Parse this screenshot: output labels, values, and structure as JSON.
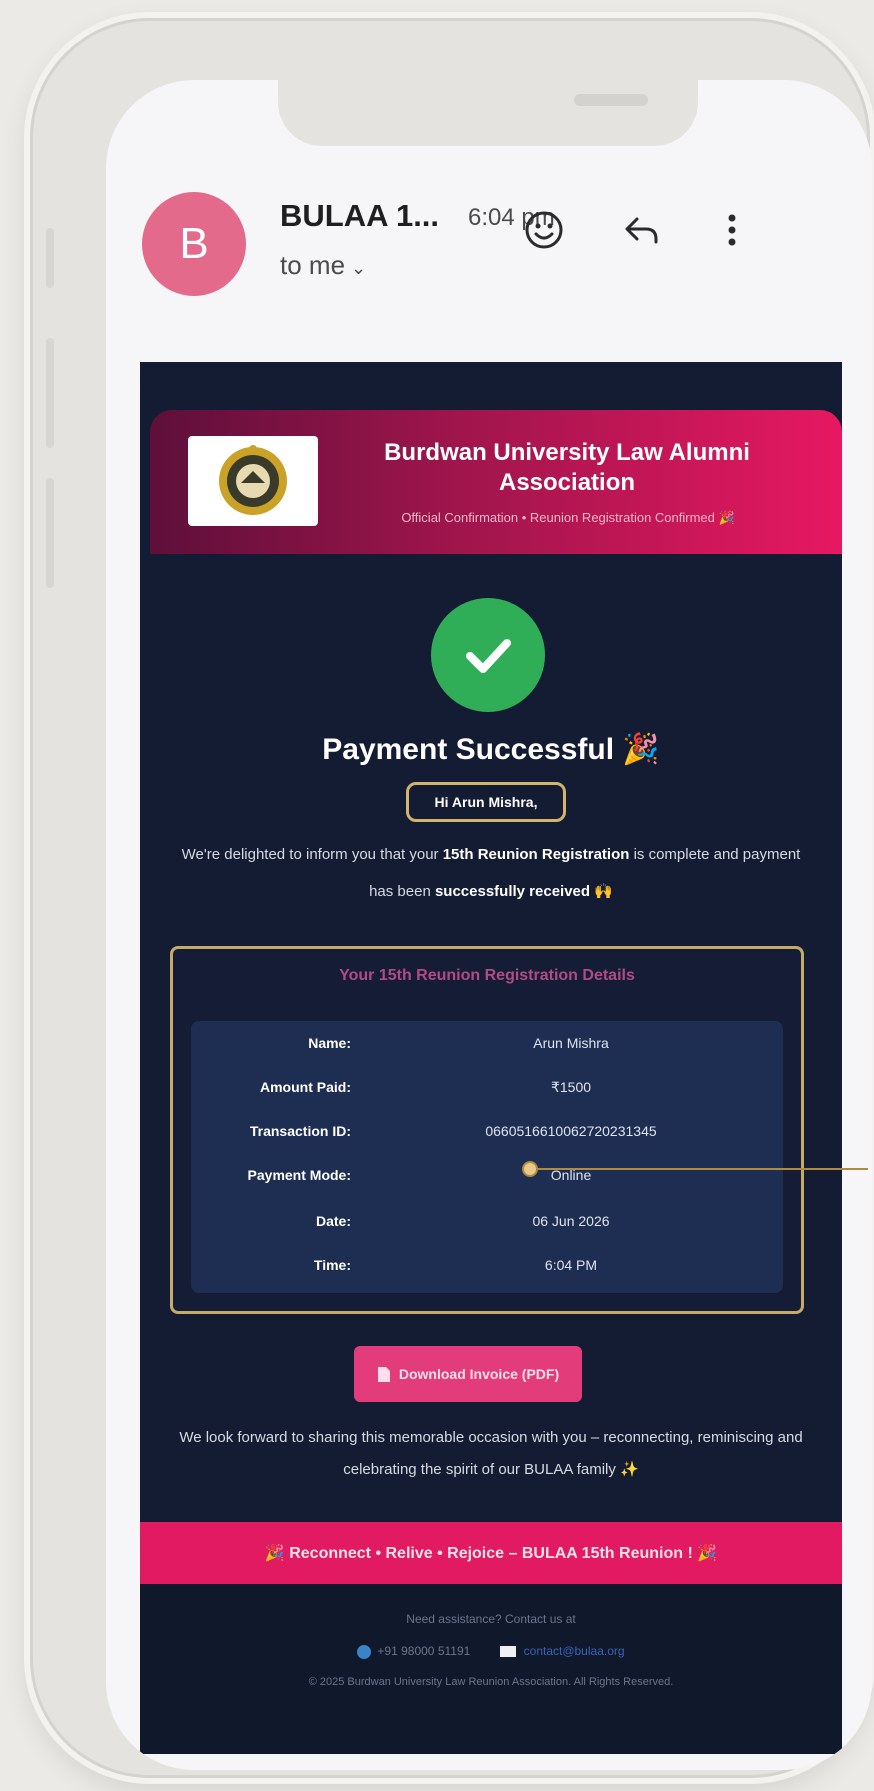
{
  "header": {
    "avatar_letter": "B",
    "sender": "BULAA 1...",
    "time": "6:04 pm",
    "recipient": "to me",
    "icons": [
      "emoji-icon",
      "reply-icon",
      "more-vert-icon"
    ]
  },
  "email": {
    "org_name": "Burdwan University Law Alumni Association",
    "subtitle": "Official Confirmation • Reunion Registration Confirmed 🎉",
    "status_title": "Payment Successful 🎉",
    "name_pill": "Hi Arun Mishra,",
    "intro_prefix": "We're delighted to inform you that your ",
    "intro_bold1": "15th Reunion Registration",
    "intro_mid": " is complete and payment has been ",
    "intro_bold2": "successfully received",
    "intro_suffix": " 🙌",
    "details_title": "Your 15th Reunion Registration Details",
    "details": [
      {
        "label": "Name:",
        "value": "Arun Mishra"
      },
      {
        "label": "Amount Paid:",
        "value": "₹1500"
      },
      {
        "label": "Transaction ID:",
        "value": "0660516610062720231345"
      },
      {
        "label": "Payment Mode:",
        "value": "Online"
      },
      {
        "label": "Date:",
        "value": "06 Jun 2026"
      },
      {
        "label": "Time:",
        "value": "6:04 PM"
      }
    ],
    "download_label": "Download Invoice (PDF)",
    "closing": "We look forward to sharing this memorable occasion with you – reconnecting, reminiscing and celebrating the spirit of our BULAA family ✨",
    "tagline": "🎉 Reconnect • Relive • Rejoice – BULAA 15th Reunion ! 🎉",
    "help_text": "Need assistance? Contact us at",
    "phone": "+91 98000 51191",
    "email_contact": "contact@bulaa.org",
    "copyright": "© 2025 Burdwan University Law Reunion Association. All Rights Reserved."
  },
  "colors": {
    "avatar": "#e36a8b",
    "banner_end": "#e71861",
    "email_bg": "#131c33",
    "success": "#2fae57",
    "gold_border": "#c7aa68",
    "button": "#e23d7a"
  }
}
